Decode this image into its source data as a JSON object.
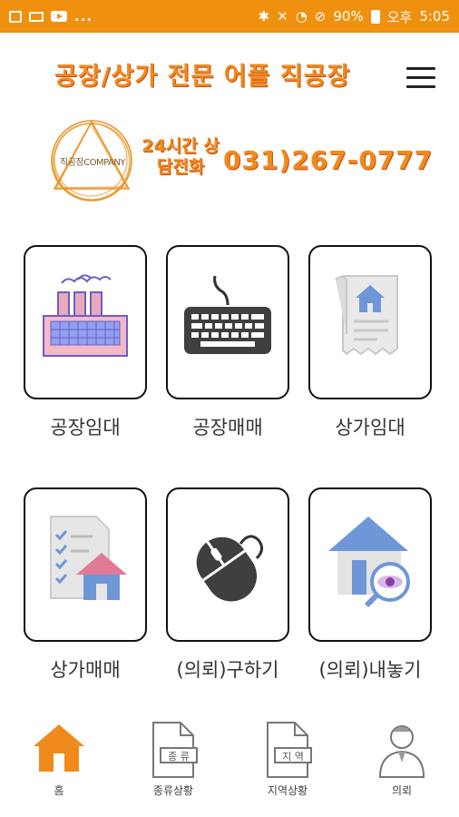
{
  "status_bar": {
    "dots": "...",
    "battery": "90%",
    "time_prefix": "오후",
    "time": "5:05"
  },
  "header": {
    "title": "공장/상가 전문 어플 직공장",
    "logo_text": "직공장COMPANY",
    "callout_label": "24시간 상담전화",
    "phone": "031)267-0777"
  },
  "tiles": [
    {
      "label": "공장임대",
      "icon": "factory-icon"
    },
    {
      "label": "공장매매",
      "icon": "keyboard-icon"
    },
    {
      "label": "상가임대",
      "icon": "house-document-icon"
    },
    {
      "label": "상가매매",
      "icon": "checklist-house-icon"
    },
    {
      "label": "(의뢰)구하기",
      "icon": "mouse-icon"
    },
    {
      "label": "(의뢰)내놓기",
      "icon": "house-search-icon"
    }
  ],
  "nav": [
    {
      "label": "홈",
      "icon": "home-icon",
      "badge": ""
    },
    {
      "label": "종류상황",
      "icon": "document-icon",
      "badge": "종 류"
    },
    {
      "label": "지역상황",
      "icon": "document-icon",
      "badge": "지 역"
    },
    {
      "label": "의뢰",
      "icon": "person-icon",
      "badge": ""
    }
  ],
  "colors": {
    "accent": "#f0900f",
    "title": "#f08a1c"
  }
}
